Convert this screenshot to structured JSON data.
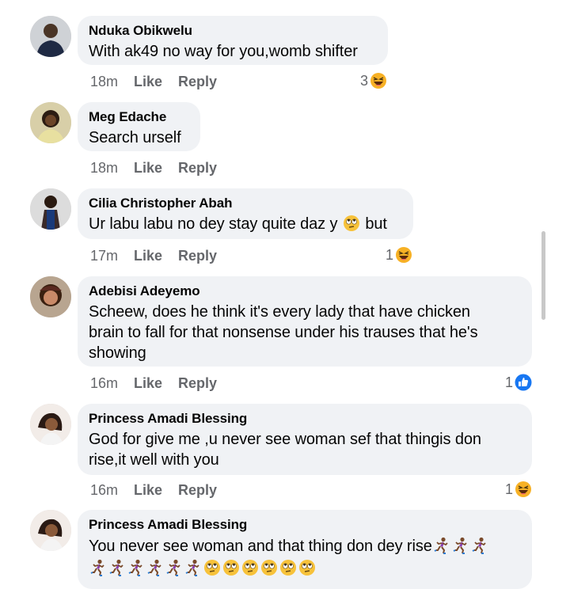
{
  "comments": [
    {
      "name": "Nduka Obikwelu",
      "text": "With ak49 no way for you,womb shifter",
      "time": "18m",
      "like": "Like",
      "reply": "Reply",
      "reaction_count": "3",
      "reaction_icon": "laughing-icon"
    },
    {
      "name": "Meg Edache",
      "text": "Search urself",
      "time": "18m",
      "like": "Like",
      "reply": "Reply"
    },
    {
      "name": "Cilia Christopher Abah",
      "text_before": "Ur labu labu no dey stay quite daz y",
      "text_after": "but",
      "inline_icon": "rolling-eyes-icon",
      "time": "17m",
      "like": "Like",
      "reply": "Reply",
      "reaction_count": "1",
      "reaction_icon": "laughing-icon"
    },
    {
      "name": "Adebisi Adeyemo",
      "text_lines": [
        "Scheew, does he think it's every lady that have chicken",
        "brain to fall for that nonsense under his trauses that he's",
        "showing"
      ],
      "time": "16m",
      "like": "Like",
      "reply": "Reply",
      "reaction_count": "1",
      "reaction_icon": "thumbs-up-icon"
    },
    {
      "name": "Princess Amadi Blessing",
      "text_lines": [
        "God for give me ,u never see woman sef that thingis don",
        "rise,it well with you"
      ],
      "time": "16m",
      "like": "Like",
      "reply": "Reply",
      "reaction_count": "1",
      "reaction_icon": "laughing-icon"
    },
    {
      "name": "Princess Amadi Blessing",
      "text": "You never see woman and that thing don dey rise",
      "emoji_line1": "running-woman-icon x3",
      "emoji_line2": "running-woman-icon x6, rolling-eyes-icon x6"
    }
  ],
  "colors": {
    "bubble": "#f0f2f5",
    "meta": "#65676b",
    "like_blue": "#1877f2",
    "emoji_yellow": "#f7b125"
  }
}
